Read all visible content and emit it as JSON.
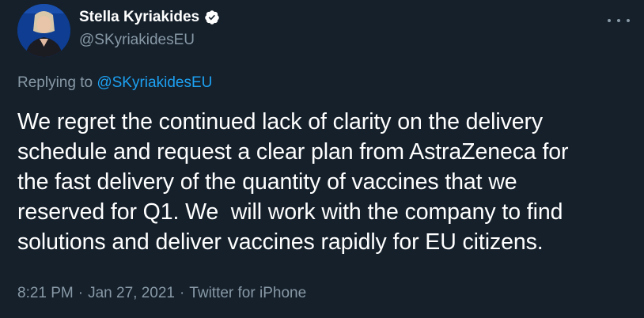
{
  "author": {
    "display_name": "Stella Kyriakides",
    "handle": "@SKyriakidesEU",
    "verified_icon": "verified-badge-icon",
    "avatar_alt": "profile photo"
  },
  "reply": {
    "prefix": "Replying to ",
    "mention": "@SKyriakidesEU"
  },
  "tweet": {
    "text": "We regret the continued lack of clarity on the delivery\nschedule and request a clear plan from AstraZeneca for\nthe fast delivery of the quantity of vaccines that we\nreserved for Q1. We  will work with the company to find\nsolutions and deliver vaccines rapidly for EU citizens."
  },
  "meta": {
    "time": "8:21 PM",
    "separator": "·",
    "date": "Jan 27, 2021",
    "source": "Twitter for iPhone"
  },
  "colors": {
    "background": "#15202b",
    "primary_text": "#ffffff",
    "secondary_text": "#8899a6",
    "accent": "#1da1f2"
  },
  "icons": {
    "more": "more-options-icon"
  }
}
